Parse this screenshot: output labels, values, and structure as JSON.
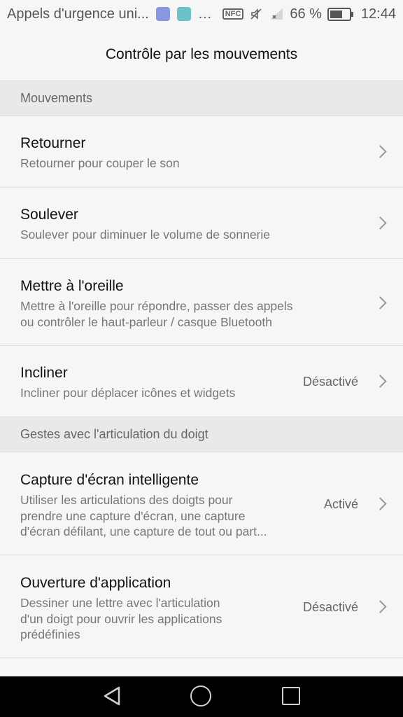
{
  "status_bar": {
    "notification_title": "Appels d'urgence uni...",
    "more_icon": "…",
    "nfc_label": "NFC",
    "battery_text": "66 %",
    "battery_level": 0.66,
    "time": "12:44"
  },
  "app_bar": {
    "title": "Contrôle par les mouvements"
  },
  "sections": [
    {
      "header": "Mouvements",
      "items": [
        {
          "title": "Retourner",
          "subtitle": [
            "Retourner pour couper le son"
          ],
          "status": ""
        },
        {
          "title": "Soulever",
          "subtitle": [
            "Soulever pour diminuer le volume de sonnerie"
          ],
          "status": ""
        },
        {
          "title": "Mettre à l'oreille",
          "subtitle": [
            "Mettre à l'oreille pour répondre, passer des appels",
            "ou contrôler le haut-parleur / casque Bluetooth"
          ],
          "status": ""
        },
        {
          "title": "Incliner",
          "subtitle": [
            "Incliner pour déplacer icônes et widgets"
          ],
          "status": "Désactivé"
        }
      ]
    },
    {
      "header": "Gestes avec l'articulation du doigt",
      "items": [
        {
          "title": "Capture d'écran intelligente",
          "subtitle": [
            "Utiliser les articulations des doigts pour",
            "prendre une capture d'écran, une capture",
            "d'écran défilant, une capture de tout ou part..."
          ],
          "status": "Activé"
        },
        {
          "title": "Ouverture d'application",
          "subtitle": [
            "Dessiner une lettre avec l'articulation",
            "d'un doigt pour ouvrir les applications",
            "prédéfinies"
          ],
          "status": "Désactivé"
        }
      ]
    }
  ],
  "icons": {
    "status_bar": [
      "health-icon",
      "gallery-icon",
      "more-icon",
      "nfc-icon",
      "mute-icon",
      "signal-icon",
      "battery-icon"
    ],
    "nav_bar": [
      "back-icon",
      "home-icon",
      "recent-apps-icon"
    ],
    "row": "chevron-right-icon"
  }
}
